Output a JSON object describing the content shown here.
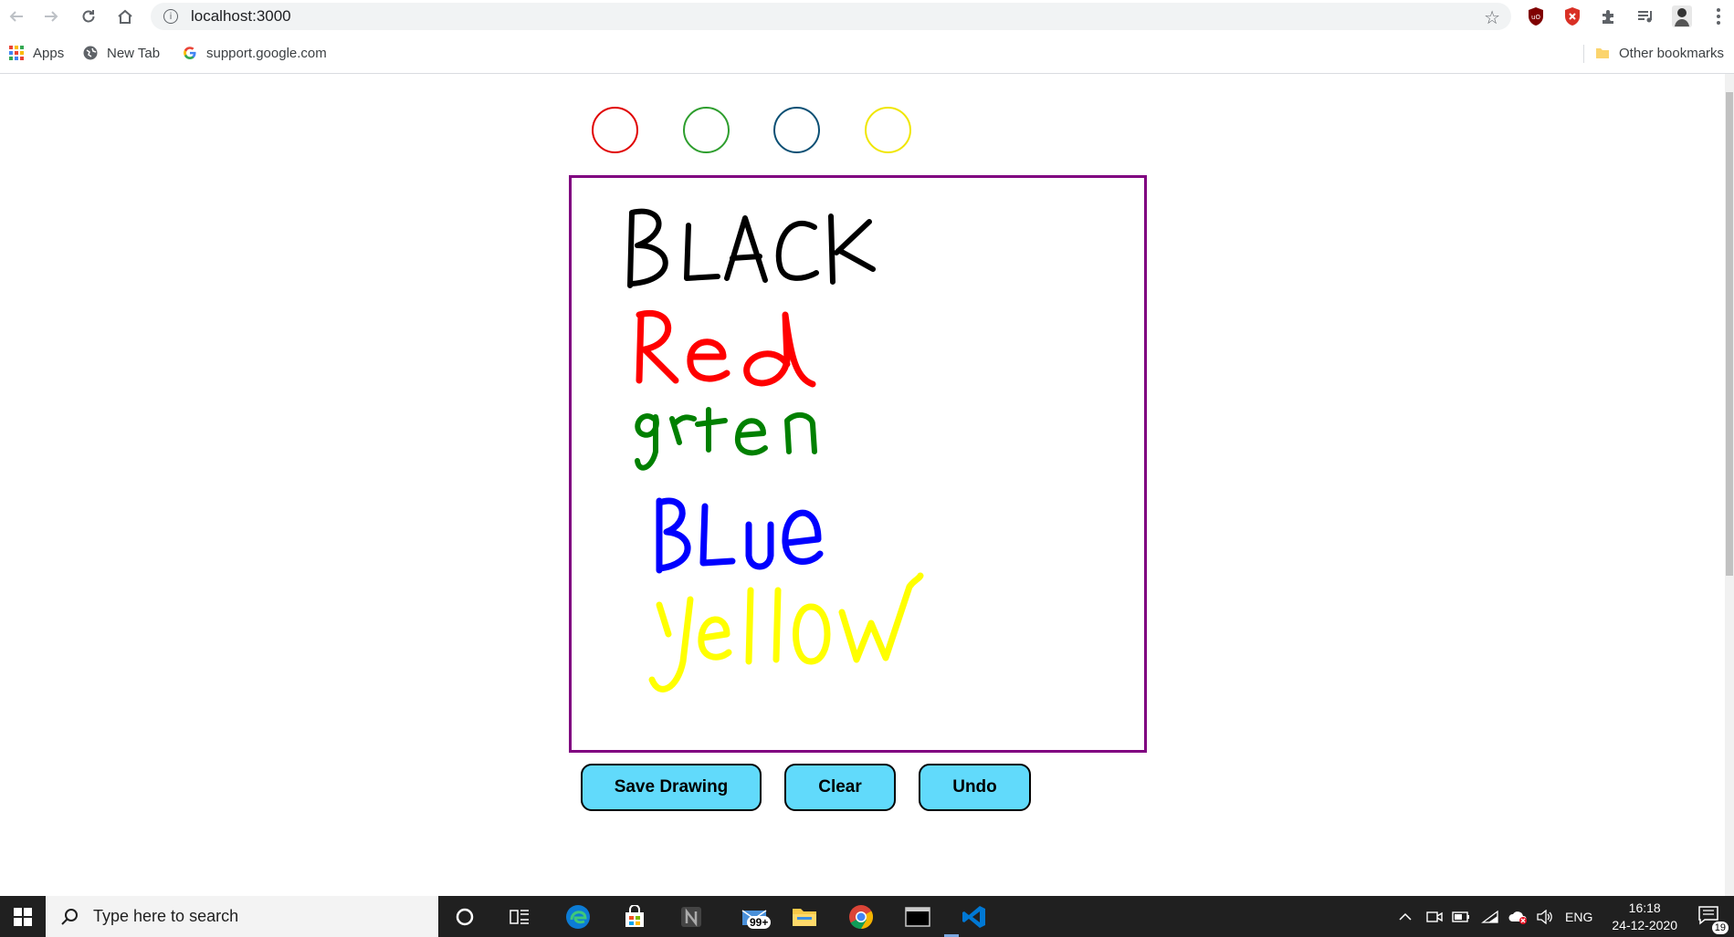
{
  "browser": {
    "url": "localhost:3000",
    "bookmarks": [
      {
        "label": "Apps"
      },
      {
        "label": "New Tab"
      },
      {
        "label": "support.google.com"
      }
    ],
    "other_bookmarks": "Other bookmarks"
  },
  "app": {
    "color_swatches": [
      {
        "name": "red",
        "color": "#e00000"
      },
      {
        "name": "green",
        "color": "#2e9e2e"
      },
      {
        "name": "blue",
        "color": "#0a4f74"
      },
      {
        "name": "yellow",
        "color": "#f0e600"
      }
    ],
    "canvas_border_color": "#800080",
    "drawing": [
      {
        "text": "BLACK",
        "color": "#000000"
      },
      {
        "text": "Red",
        "color": "#ff0000"
      },
      {
        "text": "green",
        "color": "#008000"
      },
      {
        "text": "BLue",
        "color": "#0000ff"
      },
      {
        "text": "yellow",
        "color": "#ffff00"
      }
    ],
    "buttons": {
      "save": "Save Drawing",
      "clear": "Clear",
      "undo": "Undo"
    },
    "button_color": "#61dafb"
  },
  "taskbar": {
    "search_placeholder": "Type here to search",
    "mail_badge": "99+",
    "language": "ENG",
    "time": "16:18",
    "date": "24-12-2020",
    "notification_count": "19"
  }
}
